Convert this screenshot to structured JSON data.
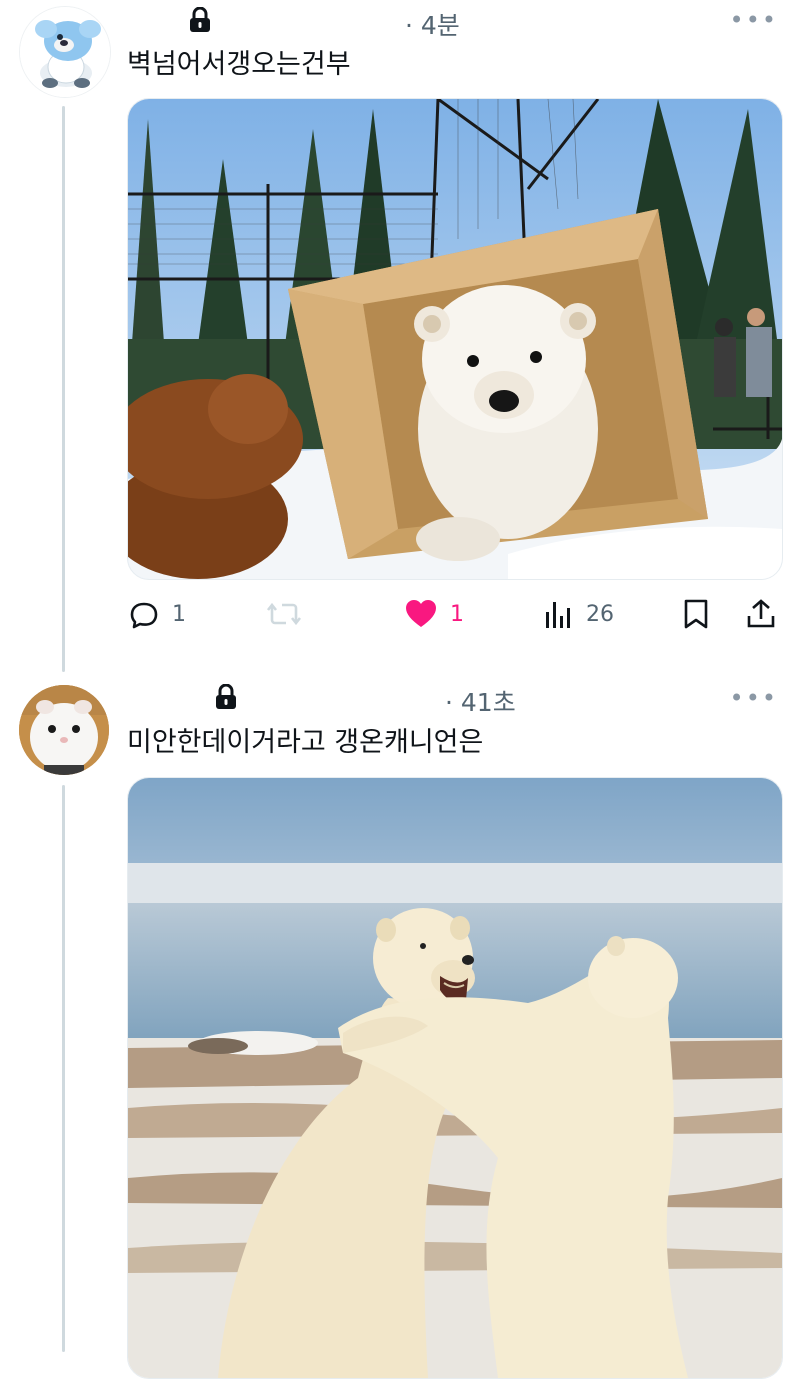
{
  "tweets": [
    {
      "time": "· 4분",
      "text": "벽넘어서갱오는건부",
      "actions": {
        "reply": "1",
        "retweet": "",
        "like": "1",
        "views": "26"
      }
    },
    {
      "time": "· 41초",
      "text": "미안한데이거라고 갱온캐니언은"
    }
  ],
  "colors": {
    "like": "#f91880",
    "muted": "#536471",
    "line": "#cfd9de"
  },
  "icons": [
    "lock-icon",
    "more-icon",
    "reply-icon",
    "retweet-icon",
    "heart-icon",
    "views-icon",
    "bookmark-icon",
    "share-icon"
  ]
}
